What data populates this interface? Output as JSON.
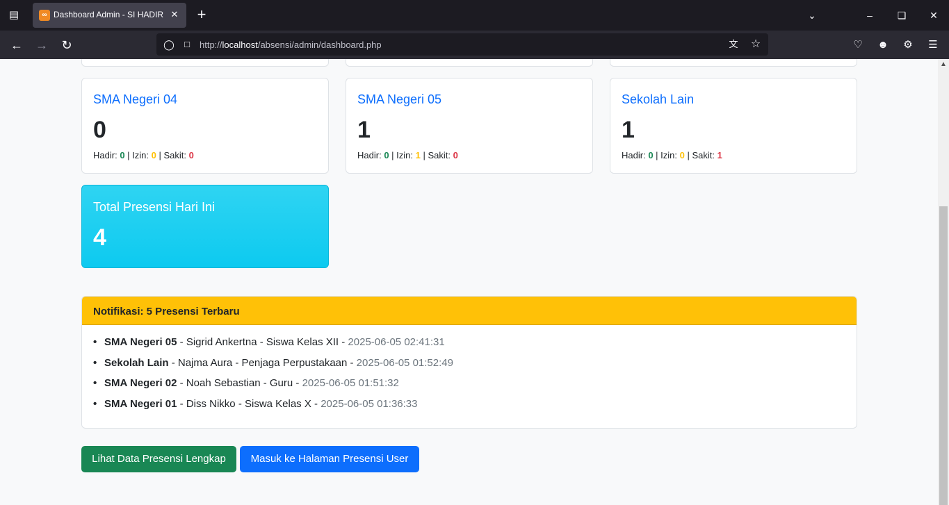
{
  "browser": {
    "tab_title": "Dashboard Admin - SI HADIR",
    "url_prefix": "http://",
    "url_host": "localhost",
    "url_path": "/absensi/admin/dashboard.php"
  },
  "cards": [
    {
      "title": "SMA Negeri 04",
      "count": "0",
      "hadir_label": "Hadir:",
      "hadir": "0",
      "izin_label": "Izin:",
      "izin": "0",
      "sakit_label": "Sakit:",
      "sakit": "0"
    },
    {
      "title": "SMA Negeri 05",
      "count": "1",
      "hadir_label": "Hadir:",
      "hadir": "0",
      "izin_label": "Izin:",
      "izin": "1",
      "sakit_label": "Sakit:",
      "sakit": "0"
    },
    {
      "title": "Sekolah Lain",
      "count": "1",
      "hadir_label": "Hadir:",
      "hadir": "0",
      "izin_label": "Izin:",
      "izin": "0",
      "sakit_label": "Sakit:",
      "sakit": "1"
    }
  ],
  "total": {
    "title": "Total Presensi Hari Ini",
    "count": "4"
  },
  "notifications": {
    "header": "Notifikasi: 5 Presensi Terbaru",
    "items": [
      {
        "school": "SMA Negeri 05",
        "detail": " - Sigrid Ankertna - Siswa Kelas XII - ",
        "time": "2025-06-05 02:41:31"
      },
      {
        "school": "Sekolah Lain",
        "detail": " - Najma Aura - Penjaga Perpustakaan - ",
        "time": "2025-06-05 01:52:49"
      },
      {
        "school": "SMA Negeri 02",
        "detail": " - Noah Sebastian - Guru - ",
        "time": "2025-06-05 01:51:32"
      },
      {
        "school": "SMA Negeri 01",
        "detail": " - Diss Nikko - Siswa Kelas X - ",
        "time": "2025-06-05 01:36:33"
      }
    ]
  },
  "actions": {
    "view_all": "Lihat Data Presensi Lengkap",
    "user_page": "Masuk ke Halaman Presensi User"
  },
  "colors": {
    "primary": "#0d6efd",
    "success": "#198754",
    "warning": "#ffc107",
    "danger": "#dc3545",
    "info": "#0dcaf0"
  }
}
